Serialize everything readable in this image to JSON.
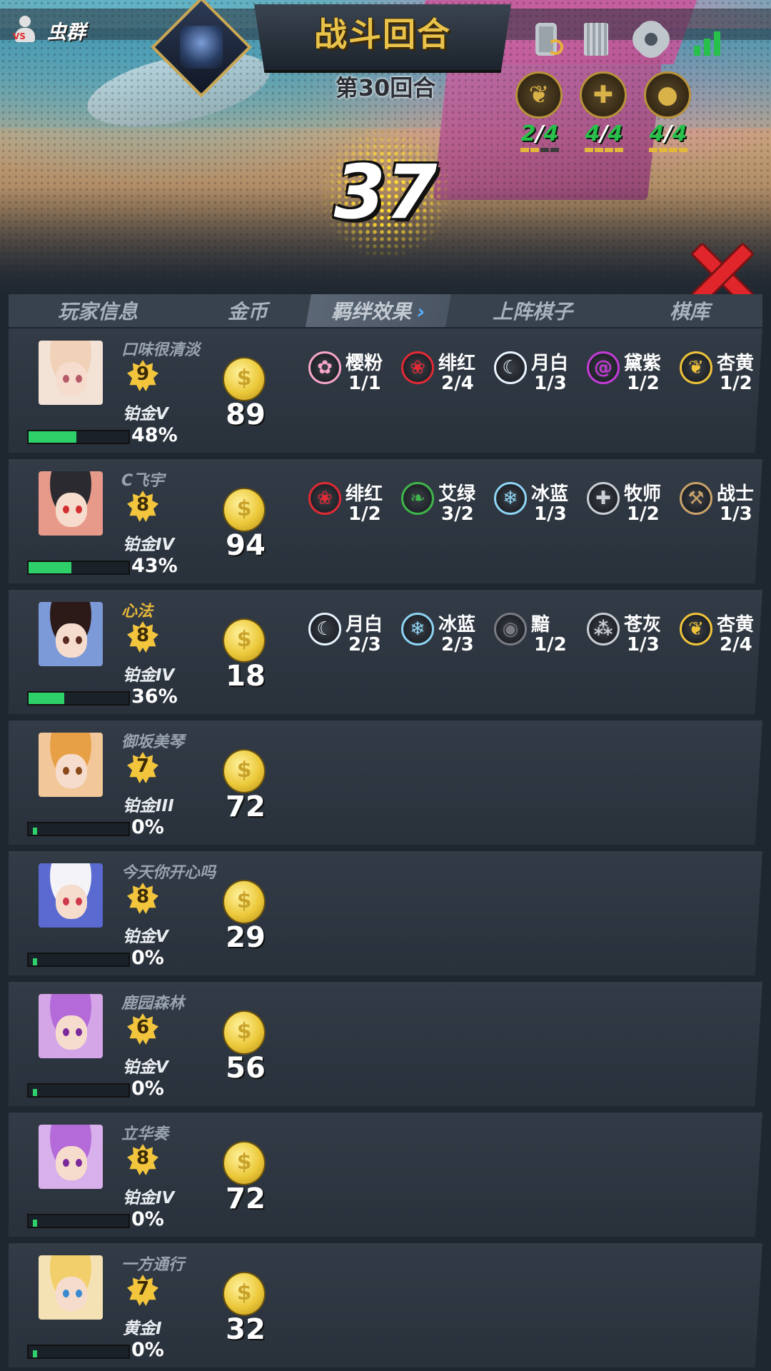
{
  "header": {
    "player_name": "虫群",
    "title": "战斗回合",
    "round": "第30回合",
    "timer": "37"
  },
  "active_bonds": [
    {
      "icon": "lotus-icon",
      "count": "2",
      "max": "4",
      "filled": 2
    },
    {
      "icon": "cross-icon",
      "count": "4",
      "max": "4",
      "filled": 4
    },
    {
      "icon": "bomb-icon",
      "count": "4",
      "max": "4",
      "filled": 4
    }
  ],
  "tabs": [
    {
      "label": "玩家信息",
      "active": false
    },
    {
      "label": "金币",
      "active": false
    },
    {
      "label": "羁绊效果",
      "active": true,
      "chevron": "›"
    },
    {
      "label": "上阵棋子",
      "active": false
    },
    {
      "label": "棋库",
      "active": false
    }
  ],
  "players": [
    {
      "name": "口味很清淡",
      "self": false,
      "level": "9",
      "rank": "铂金V",
      "xp": "48%",
      "xp_fill": 0.48,
      "gold": "89",
      "portrait": {
        "hair": "#f1d2b8",
        "bg": "#f3e3d6",
        "eye": "#b65a6a"
      },
      "bonds": [
        {
          "name": "樱粉",
          "count": "1/1",
          "icon": "blossom-icon",
          "color": "#f7a7c8",
          "glyph": "✿"
        },
        {
          "name": "绯红",
          "count": "2/4",
          "icon": "rose-icon",
          "color": "#e02a35",
          "glyph": "❀"
        },
        {
          "name": "月白",
          "count": "1/3",
          "icon": "moon-icon",
          "color": "#e8f4ff",
          "glyph": "☾"
        },
        {
          "name": "黛紫",
          "count": "1/2",
          "icon": "spiral-icon",
          "color": "#c33bd6",
          "glyph": "@"
        },
        {
          "name": "杏黄",
          "count": "1/2",
          "icon": "lotus-icon",
          "color": "#f0c43a",
          "glyph": "❦"
        }
      ]
    },
    {
      "name": "C飞宇",
      "self": false,
      "level": "8",
      "rank": "铂金IV",
      "xp": "43%",
      "xp_fill": 0.43,
      "gold": "94",
      "portrait": {
        "hair": "#2a2a30",
        "bg": "#e89a8a",
        "eye": "#d23030"
      },
      "bonds": [
        {
          "name": "绯红",
          "count": "1/2",
          "icon": "rose-icon",
          "color": "#e02a35",
          "glyph": "❀"
        },
        {
          "name": "艾绿",
          "count": "3/2",
          "icon": "leaf-icon",
          "color": "#3fb54a",
          "glyph": "❧"
        },
        {
          "name": "冰蓝",
          "count": "1/3",
          "icon": "snowflake-icon",
          "color": "#8ed4f4",
          "glyph": "❄"
        },
        {
          "name": "牧师",
          "count": "1/2",
          "icon": "cross-icon",
          "color": "#c9ced4",
          "glyph": "✚"
        },
        {
          "name": "战士",
          "count": "1/3",
          "icon": "hammer-icon",
          "color": "#c9a26a",
          "glyph": "⚒"
        }
      ]
    },
    {
      "name": "心法",
      "self": true,
      "level": "8",
      "rank": "铂金IV",
      "xp": "36%",
      "xp_fill": 0.36,
      "gold": "18",
      "portrait": {
        "hair": "#2c1a18",
        "bg": "#7d9ad8",
        "eye": "#5a2a20"
      },
      "bonds": [
        {
          "name": "月白",
          "count": "2/3",
          "icon": "moon-icon",
          "color": "#e8f4ff",
          "glyph": "☾"
        },
        {
          "name": "冰蓝",
          "count": "2/3",
          "icon": "snowflake-icon",
          "color": "#8ed4f4",
          "glyph": "❄"
        },
        {
          "name": "黯",
          "count": "1/2",
          "icon": "eye-icon",
          "color": "#7a7a82",
          "glyph": "◉"
        },
        {
          "name": "苍灰",
          "count": "1/3",
          "icon": "triad-icon",
          "color": "#c9ced4",
          "glyph": "⁂"
        },
        {
          "name": "杏黄",
          "count": "2/4",
          "icon": "lotus-icon",
          "color": "#f0c43a",
          "glyph": "❦"
        }
      ]
    },
    {
      "name": "御坂美琴",
      "self": false,
      "level": "7",
      "rank": "铂金III",
      "xp": "0%",
      "xp_fill": 0,
      "gold": "72",
      "portrait": {
        "hair": "#e8a046",
        "bg": "#f2c89a",
        "eye": "#8a4a1a"
      },
      "bonds": []
    },
    {
      "name": "今天你开心吗",
      "self": false,
      "level": "8",
      "rank": "铂金V",
      "xp": "0%",
      "xp_fill": 0,
      "gold": "29",
      "portrait": {
        "hair": "#f4f4f8",
        "bg": "#5a6ad0",
        "eye": "#d03a4a"
      },
      "bonds": []
    },
    {
      "name": "鹿园森林",
      "self": false,
      "level": "6",
      "rank": "铂金V",
      "xp": "0%",
      "xp_fill": 0,
      "gold": "56",
      "portrait": {
        "hair": "#b46ad8",
        "bg": "#d4a6e8",
        "eye": "#7a2a9a"
      },
      "bonds": []
    },
    {
      "name": "立华奏",
      "self": false,
      "level": "8",
      "rank": "铂金IV",
      "xp": "0%",
      "xp_fill": 0,
      "gold": "72",
      "portrait": {
        "hair": "#b46ad8",
        "bg": "#d8b0ec",
        "eye": "#7a2a9a"
      },
      "bonds": []
    },
    {
      "name": "一方通行",
      "self": false,
      "level": "7",
      "rank": "黄金I",
      "xp": "0%",
      "xp_fill": 0,
      "gold": "32",
      "portrait": {
        "hair": "#f2cf6a",
        "bg": "#f4e2b4",
        "eye": "#3a8ad0"
      },
      "bonds": []
    }
  ]
}
